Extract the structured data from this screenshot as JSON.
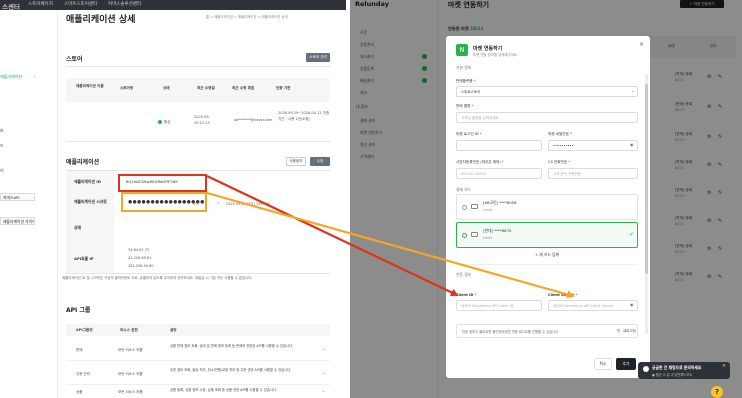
{
  "left": {
    "topnav": [
      "스토어페이지",
      "스마트스토어센터",
      "커머스솔루션센터"
    ],
    "sidebar_active": "애플리케이션",
    "sidebar_boxes": [
      "커머스API",
      "애플리케이션 가이드"
    ],
    "title": "애플리케이션 상세",
    "breadcrumb": "홈 > 애플리케이션 > 애플리케이션 > 애플리케이션 상세",
    "store": {
      "section_title": "스토어",
      "button": "스토어 관리",
      "headers": [
        "애플리케이션 이름",
        "스토어명",
        "상태",
        "최근 수정일",
        "최근 수정 회원",
        "인증 기한"
      ],
      "status": "활성",
      "updated": "2025-09-29 17:13",
      "member": "od*******@naver.com",
      "expiry": "2026-09-29~2026-04-11 인증 기간 : 사용 1년(도중)"
    },
    "app": {
      "section_title": "애플리케이션",
      "btn_edit": "사용중지",
      "btn_save": "수정",
      "id_label": "애플리케이션 ID",
      "id_value": "6Q1ksS32IwWLVfkeZYP7d9",
      "secret_label": "애플리케이션 시크릿",
      "secret_value": "●●●●●●●●●●●●●●●●●",
      "secret_btn": "보기",
      "secret_date": "2025-09-28 발급 | SYSTEM",
      "status_label": "상태",
      "ip_label": "API호출 IP",
      "ip_values": [
        "34.64.92.73",
        "43.200.69.81",
        "182.208.92.60"
      ]
    },
    "note": "애플리케이션 ID 및 시크릿은 가상의 클라이언트 키로, 유출되지 않도록 주의하여 관리하세요. 재발급 시 기존 키는 사용할 수 없습니다.",
    "group": {
      "section_title": "API 그룹",
      "headers": [
        "API그룹명",
        "리소스 권한",
        "설명"
      ],
      "rows": [
        {
          "name": "판매",
          "perm": "모든 리소스 허용",
          "desc": "상품 판매 정보 조회, 상태 및 판매 정보 등록 등 판매와 관련된 API를 사용할 수 있습니다."
        },
        {
          "name": "주문 관리",
          "perm": "모든 리소스 허용",
          "desc": "주문 정보 조회, 발송 처리, 취소/반품/교환 처리 등 주문 관련 API를 사용할 수 있습니다."
        },
        {
          "name": "상품",
          "perm": "모든 리소스 허용",
          "desc": "상품 등록, 상품 정보 수정, 상품 조회 등 상품 관련 API를 사용할 수 있습니다."
        }
      ]
    }
  },
  "right": {
    "logo": "Relunday",
    "page_title": "마켓 연동하기",
    "header_button": "+ 마켓 연동하기",
    "subtitle_prefix": "연동된 마켓",
    "subtitle_count": "10/11",
    "sidebar_items": [
      "주문",
      "상품관리",
      "재고관리",
      "상품등록",
      "배송관리",
      "재고",
      "내 정보",
      "결제 관리",
      "마켓 연동하기",
      "정산 관리",
      "고객센터"
    ],
    "table_headers": [
      "쇼핑몰",
      "판매처명",
      "연동일시",
      "상태",
      "관리"
    ],
    "table_row_value": "[판매] 등록",
    "table_row_sub": "8870",
    "modal": {
      "title": "마켓 연동하기",
      "subtitle": "마켓 연동 정보를 입력해주세요.",
      "close": "×",
      "section_basic": "기본 정보",
      "market_label": "판매플랫폼",
      "market_value": "스마트스토어",
      "seller_label": "판매 별명",
      "seller_placeholder": "고객님 별명을 입력하세요",
      "login_label": "마켓 로그인 ID",
      "password_label": "마켓 비밀번호",
      "password_value": "••••••••••",
      "biz_label": "사업자등록번호 (하이픈 제외)",
      "biz_placeholder": "000-00-00000",
      "cs_label": "CS 전화번호",
      "cs_placeholder": "고객 문의 전화번호",
      "section_card": "결제 카드",
      "cards": [
        {
          "name": "[KB국민] ****8058",
          "type": "credit",
          "selected": false
        },
        {
          "name": "[현대] ****6870",
          "type": "credit",
          "selected": true
        }
      ],
      "add_card": "+ 새 카드 등록",
      "section_api": "연동 정보",
      "client_id_label": "Client ID",
      "client_id_placeholder": "네이버 Commerce API Client ID",
      "client_secret_label": "Client Secret",
      "client_secret_placeholder": "네이버 Commerce API Client Secret",
      "info_text": "연동 정보가 올바르면 확인하여야만 연동 테스트를 진행할 수 있습니다.",
      "refresh_label": "새로고침",
      "cancel": "취소",
      "submit": "추가"
    },
    "toast_title": "궁금한 건 채팅으로 문의하세요",
    "toast_sub": "● 평균 수 분 내 답변해드려요",
    "help_icon": "?"
  },
  "colors": {
    "highlight_red": "#e0321e",
    "highlight_orange": "#f5a623",
    "brand_green": "#2bb24c"
  }
}
